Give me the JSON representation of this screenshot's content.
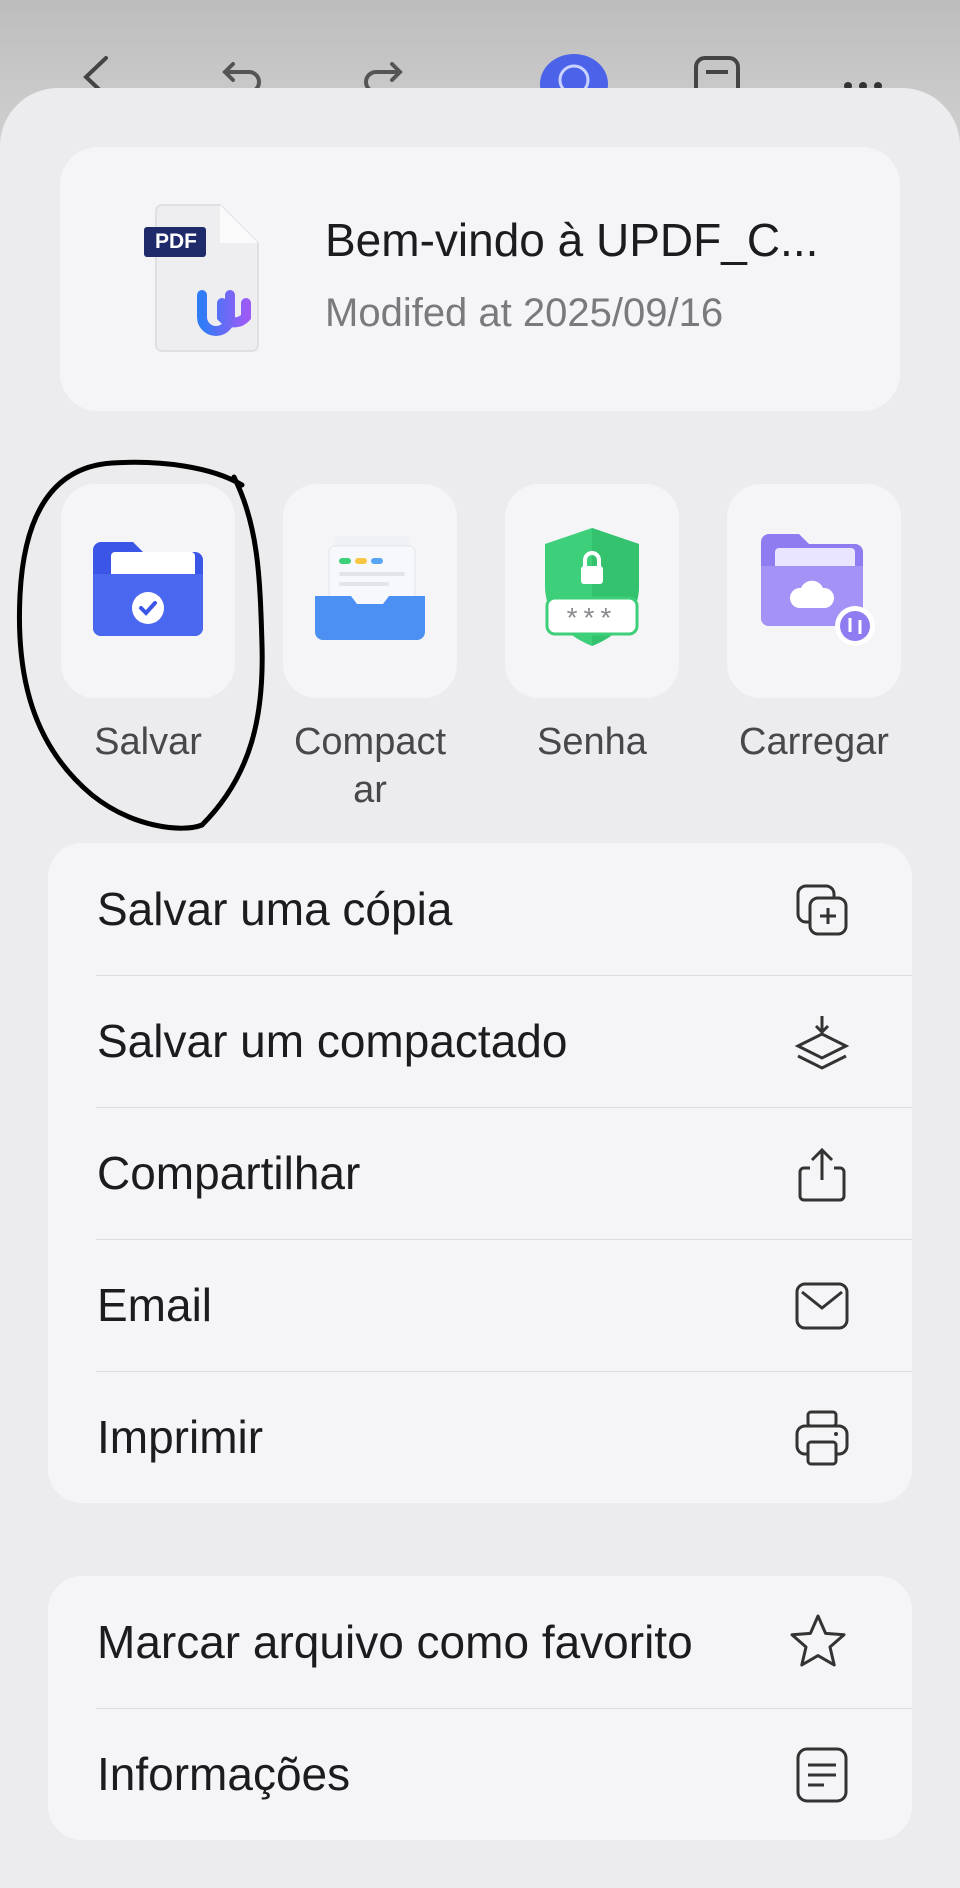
{
  "toolbar": {
    "icons": [
      "back-icon",
      "undo-icon",
      "redo-icon",
      "ai-assistant-icon",
      "comment-icon",
      "more-icon"
    ]
  },
  "file": {
    "name": "Bem-vindo à UPDF_C...",
    "modified": "Modifed at 2025/09/16",
    "badge": "PDF"
  },
  "actions": [
    {
      "label": "Salvar",
      "icon": "save-folder-icon"
    },
    {
      "label": "Compactar",
      "label_line1": "Compact",
      "label_line2": "ar",
      "icon": "compress-tray-icon"
    },
    {
      "label": "Senha",
      "icon": "password-shield-icon",
      "mask": "***"
    },
    {
      "label": "Carregar",
      "icon": "cloud-upload-folder-icon"
    }
  ],
  "menu_primary": [
    {
      "label": "Salvar uma cópia",
      "icon": "duplicate-icon"
    },
    {
      "label": "Salvar um compactado",
      "icon": "compress-download-icon"
    },
    {
      "label": "Compartilhar",
      "icon": "share-icon"
    },
    {
      "label": "Email",
      "icon": "mail-icon"
    },
    {
      "label": "Imprimir",
      "icon": "printer-icon"
    }
  ],
  "menu_secondary": [
    {
      "label": "Marcar arquivo como favorito",
      "icon": "star-icon"
    },
    {
      "label": "Informações",
      "icon": "document-info-icon"
    }
  ],
  "colors": {
    "accent_blue": "#3f5df0",
    "shield_green": "#3ecf7a",
    "upload_purple": "#9a85f0"
  }
}
